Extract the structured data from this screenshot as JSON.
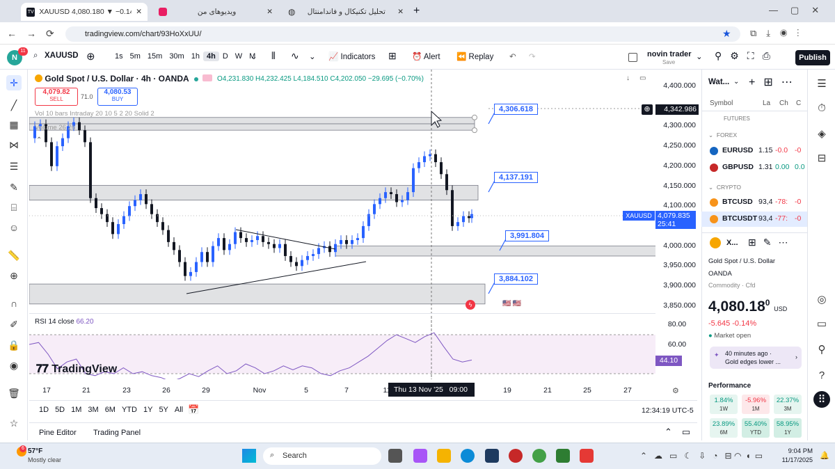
{
  "browser": {
    "tab1": "XAUUSD 4,080.180 ▼ −0.14% ...",
    "tab2": "ویدیوهای من",
    "tab3": "تحلیل تکنیکال و فاندامنتال",
    "url": "tradingview.com/chart/93HoXxUU/"
  },
  "toolbar": {
    "avatar": "N",
    "badge": "11",
    "symbol": "XAUUSD",
    "tf": [
      "1s",
      "5m",
      "15m",
      "30m",
      "1h",
      "4h",
      "D",
      "W",
      "M"
    ],
    "indicators": "Indicators",
    "alert": "Alert",
    "replay": "Replay",
    "account": "novin trader",
    "save": "Save",
    "publish": "Publish"
  },
  "legend": {
    "title": "Gold Spot / U.S. Dollar · 4h · OANDA",
    "ohlc": "O4,231.830 H4,232.425 L4,184.510 C4,202.050 −29.695 (−0.70%)",
    "sell_price": "4,079.82",
    "sell": "SELL",
    "spread": "71.0",
    "buy_price": "4,080.53",
    "buy": "BUY",
    "ind1": "Vol 10 bars Intraday 20 10 5 2 20 Solid 2",
    "ind2": "Volume 26 26"
  },
  "chart_data": {
    "type": "candlestick",
    "y_ticks": [
      "4,400.000",
      "4,300.000",
      "4,250.000",
      "4,200.000",
      "4,150.000",
      "4,100.000",
      "4,000.000",
      "3,950.000",
      "3,900.000",
      "3,850.000"
    ],
    "x_ticks": [
      "17",
      "21",
      "23",
      "26",
      "29",
      "Nov",
      "5",
      "7",
      "11",
      "19",
      "21",
      "25",
      "27"
    ],
    "x_cursor": "Thu 13 Nov '25",
    "x_cursor_time": "09:00",
    "crosshair_price": "4,342.986",
    "last_symbol": "XAUUSD",
    "last_price": "4,079.835",
    "countdown": "25:41",
    "levels": [
      "4,306.618",
      "4,137.191",
      "3,991.804",
      "3,884.102"
    ]
  },
  "rsi": {
    "label": "RSI 14 close",
    "value": "66.20",
    "ticks": [
      "80.00",
      "60.00",
      "40.00"
    ],
    "current": "44.10"
  },
  "watermark": "TradingView",
  "bottom": {
    "ranges": [
      "1D",
      "5D",
      "1M",
      "3M",
      "6M",
      "YTD",
      "1Y",
      "5Y",
      "All"
    ],
    "clock": "12:34:19 UTC-5",
    "pine": "Pine Editor",
    "panel": "Trading Panel"
  },
  "watchlist": {
    "title": "Wat...",
    "cols": [
      "Symbol",
      "La",
      "Ch",
      "C"
    ],
    "sec0": "FUTURES",
    "sec1": "FOREX",
    "sec2": "CRYPTO",
    "rows": [
      {
        "sym": "EURUSD",
        "last": "1.15",
        "ch": "-0.0",
        "chp": "-0",
        "col": "#f23645"
      },
      {
        "sym": "GBPUSD",
        "last": "1.31",
        "ch": "0.00",
        "chp": "0.0",
        "col": "#089981"
      },
      {
        "sym": "BTCUSD",
        "last": "93,4",
        "ch": "-78:",
        "chp": "-0",
        "col": "#f23645"
      },
      {
        "sym": "BTCUSDT",
        "last": "93,4",
        "ch": "-77:",
        "chp": "-0",
        "col": "#f23645"
      }
    ]
  },
  "details": {
    "sym": "X...",
    "name": "Gold Spot / U.S. Dollar",
    "broker": "OANDA",
    "cat": "Commodity · Cfd",
    "price_big": "4,080.18",
    "price_sup": "0",
    "ccy": "USD",
    "change": "-5.645  -0.14%",
    "status": "Market open",
    "news_time": "40 minutes ago ·",
    "news": "Gold edges lower ...",
    "perf_title": "Performance",
    "perf": [
      {
        "v": "1.84%",
        "p": "1W",
        "bg": "#e6f5f0",
        "c": "#089981"
      },
      {
        "v": "-5.96%",
        "p": "1M",
        "bg": "#fde8ea",
        "c": "#f23645"
      },
      {
        "v": "22.37%",
        "p": "3M",
        "bg": "#e6f5f0",
        "c": "#089981"
      },
      {
        "v": "23.89%",
        "p": "6M",
        "bg": "#e6f5f0",
        "c": "#089981"
      },
      {
        "v": "55.40%",
        "p": "YTD",
        "bg": "#d2eee4",
        "c": "#089981"
      },
      {
        "v": "58.95%",
        "p": "1Y",
        "bg": "#d2eee4",
        "c": "#089981"
      }
    ]
  },
  "taskbar": {
    "temp": "57°F",
    "weather": "Mostly clear",
    "search": "Search",
    "time": "9:04 PM",
    "date": "11/17/2025",
    "notif": "6"
  }
}
